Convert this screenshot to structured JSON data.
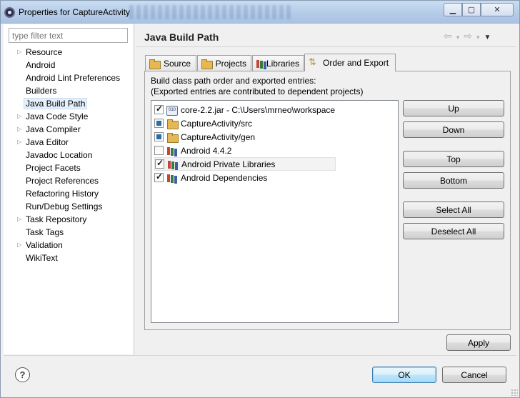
{
  "window": {
    "title": "Properties for CaptureActivity"
  },
  "filter": {
    "placeholder": "type filter text"
  },
  "sidebar": {
    "items": [
      {
        "label": "Resource",
        "expandable": true
      },
      {
        "label": "Android",
        "expandable": false
      },
      {
        "label": "Android Lint Preferences",
        "expandable": false
      },
      {
        "label": "Builders",
        "expandable": false
      },
      {
        "label": "Java Build Path",
        "expandable": false,
        "selected": true
      },
      {
        "label": "Java Code Style",
        "expandable": true
      },
      {
        "label": "Java Compiler",
        "expandable": true
      },
      {
        "label": "Java Editor",
        "expandable": true
      },
      {
        "label": "Javadoc Location",
        "expandable": false
      },
      {
        "label": "Project Facets",
        "expandable": false
      },
      {
        "label": "Project References",
        "expandable": false
      },
      {
        "label": "Refactoring History",
        "expandable": false
      },
      {
        "label": "Run/Debug Settings",
        "expandable": false
      },
      {
        "label": "Task Repository",
        "expandable": true
      },
      {
        "label": "Task Tags",
        "expandable": false
      },
      {
        "label": "Validation",
        "expandable": true
      },
      {
        "label": "WikiText",
        "expandable": false
      }
    ]
  },
  "header": {
    "title": "Java Build Path"
  },
  "tabs": [
    {
      "label": "Source",
      "icon": "folder-icon"
    },
    {
      "label": "Projects",
      "icon": "folder-icon"
    },
    {
      "label": "Libraries",
      "icon": "books-icon"
    },
    {
      "label": "Order and Export",
      "icon": "order-icon",
      "active": true
    }
  ],
  "panel": {
    "desc_line1": "Build class path order and exported entries:",
    "desc_line2": "(Exported entries are contributed to dependent projects)"
  },
  "entries": [
    {
      "label": "core-2.2.jar - C:\\Users\\mrneo\\workspace",
      "icon": "jar-icon",
      "state": "checked"
    },
    {
      "label": "CaptureActivity/src",
      "icon": "folder-icon",
      "state": "partial"
    },
    {
      "label": "CaptureActivity/gen",
      "icon": "folder-icon",
      "state": "partial"
    },
    {
      "label": "Android 4.4.2",
      "icon": "books-icon",
      "state": "unchecked"
    },
    {
      "label": "Android Private Libraries",
      "icon": "books-icon",
      "state": "checked"
    },
    {
      "label": "Android Dependencies",
      "icon": "books-icon",
      "state": "checked"
    }
  ],
  "buttons": {
    "up": "Up",
    "down": "Down",
    "top": "Top",
    "bottom": "Bottom",
    "select_all": "Select All",
    "deselect_all": "Deselect All",
    "apply": "Apply",
    "ok": "OK",
    "cancel": "Cancel"
  },
  "help": {
    "symbol": "?"
  }
}
